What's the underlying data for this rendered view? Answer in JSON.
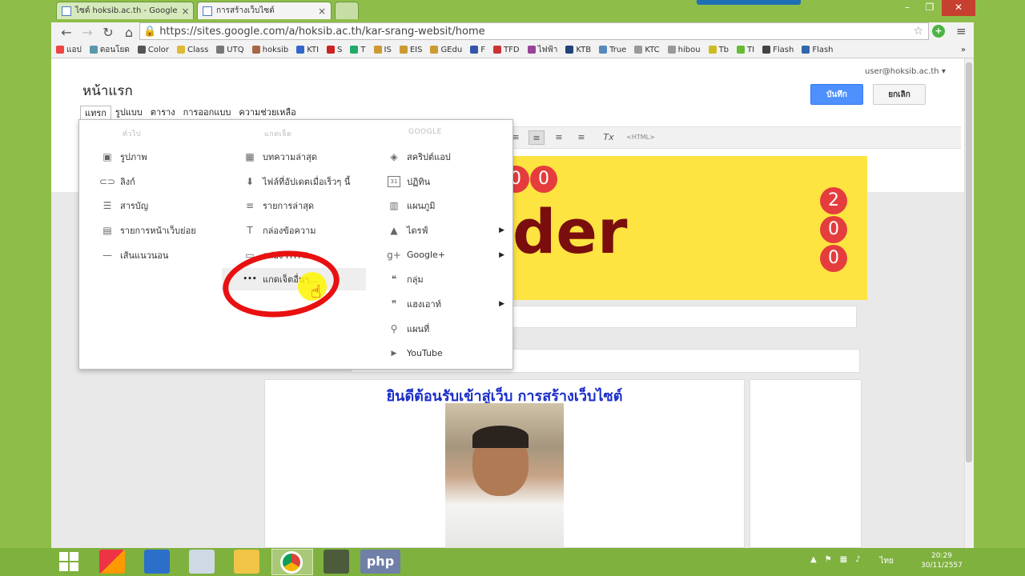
{
  "browser": {
    "tabs": [
      {
        "label": "ไซต์ hoksib.ac.th - Google"
      },
      {
        "label": "การสร้างเว็บไซต์"
      }
    ],
    "url": "https://sites.google.com/a/hoksib.ac.th/kar-srang-websit/home",
    "bookmarks": [
      "แอป",
      "ดอนโยด",
      "Color",
      "Class",
      "UTQ",
      "hoksib",
      "KTI",
      "S",
      "T",
      "IS",
      "EIS",
      "GEdu",
      "F",
      "TFD",
      "ไฟฟ้า",
      "KTB",
      "True",
      "KTC",
      "hibou",
      "Tb",
      "TI",
      "Flash",
      "Flash"
    ]
  },
  "page": {
    "title": "หน้าแรก",
    "user_email": "user@hoksib.ac.th",
    "save_label": "บันทึก",
    "cancel_label": "ยกเลิก",
    "menu": [
      "แทรก",
      "รูปแบบ",
      "ตาราง",
      "การออกแบบ",
      "ความช่วยเหลือ"
    ],
    "html_label": "<HTML>"
  },
  "insert_menu": {
    "col1_header": "ทั่วไป",
    "col2_header": "แกดเจ็ต",
    "col3_header": "GOOGLE",
    "col1": [
      {
        "label": "รูปภาพ",
        "icon": "image-icon"
      },
      {
        "label": "ลิงก์",
        "icon": "link-icon"
      },
      {
        "label": "สารบัญ",
        "icon": "toc-icon"
      },
      {
        "label": "รายการหน้าเว็บย่อย",
        "icon": "subpages-icon"
      },
      {
        "label": "เส้นแนวนอน",
        "icon": "hr-icon"
      }
    ],
    "col2": [
      {
        "label": "บทความล่าสุด",
        "icon": "recent-posts-icon"
      },
      {
        "label": "ไฟล์ที่อัปเดตเมื่อเร็วๆ นี้",
        "icon": "recent-files-icon"
      },
      {
        "label": "รายการล่าสุด",
        "icon": "recent-list-icon"
      },
      {
        "label": "กล่องข้อความ",
        "icon": "textbox-icon"
      },
      {
        "label": "กล่อง HTML",
        "icon": "html-box-icon"
      },
      {
        "label": "แกดเจ็ตอื่นๆ...",
        "icon": "more-icon"
      }
    ],
    "col3": [
      {
        "label": "สคริปต์แอป",
        "icon": "apps-script-icon",
        "submenu": false
      },
      {
        "label": "ปฏิทิน",
        "icon": "calendar-icon",
        "submenu": false
      },
      {
        "label": "แผนภูมิ",
        "icon": "chart-icon",
        "submenu": false
      },
      {
        "label": "ไดรฟ์",
        "icon": "drive-icon",
        "submenu": true
      },
      {
        "label": "Google+",
        "icon": "google-plus-icon",
        "submenu": true
      },
      {
        "label": "กลุ่ม",
        "icon": "groups-icon",
        "submenu": false
      },
      {
        "label": "แฮงเอาท์",
        "icon": "hangouts-icon",
        "submenu": true
      },
      {
        "label": "แผนที่",
        "icon": "map-icon",
        "submenu": false
      },
      {
        "label": "YouTube",
        "icon": "youtube-icon",
        "submenu": false
      }
    ]
  },
  "banner": {
    "big_text": "der",
    "top_circles": [
      "0",
      "0"
    ],
    "side_circles": [
      "2",
      "0",
      "0"
    ]
  },
  "content": {
    "welcome": "ยินดีต้อนรับเข้าสู่เว็บ การสร้างเว็บไซต์"
  },
  "taskbar": {
    "php_label": "php",
    "lang": "ไทย",
    "time": "20:29",
    "date": "30/11/2557"
  }
}
